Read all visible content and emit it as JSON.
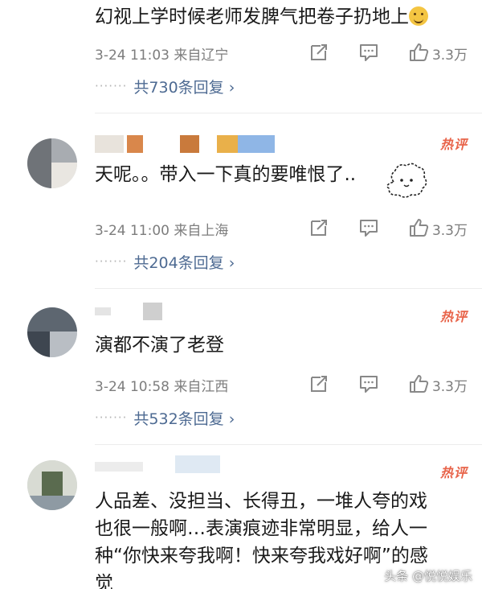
{
  "comments": [
    {
      "text": "幻视上学时候老师发脾气把卷子扔地上",
      "time_location": "3-24 11:03 来自辽宁",
      "likes": "3.3万",
      "replies": "共730条回复",
      "emoji": "smile-emoji"
    },
    {
      "hot_label": "热评",
      "text": "天呢。。带入一下真的要唯恨了..",
      "time_location": "3-24 11:00 来自上海",
      "likes": "3.3万",
      "replies": "共204条回复",
      "sticker": "fluffy-sheep-sticker"
    },
    {
      "hot_label": "热评",
      "text": "演都不演了老登",
      "time_location": "3-24 10:58 来自江西",
      "likes": "3.3万",
      "replies": "共532条回复"
    },
    {
      "hot_label": "热评",
      "text_lines": [
        "人品差、没担当、长得丑，一堆人夸的戏",
        "也很一般啊…表演痕迹非常明显，给人一",
        "种“你快来夸我啊！快来夸我戏好啊”的感",
        "觉"
      ]
    }
  ],
  "reply_more_chevron": "›",
  "watermark": "头条 @悦悦娱乐",
  "icons": [
    "share-icon",
    "comment-icon",
    "like-icon"
  ],
  "colors": {
    "reply_link": "#4d6a92",
    "hot": "#e8644a",
    "meta": "#7d7d7d"
  }
}
